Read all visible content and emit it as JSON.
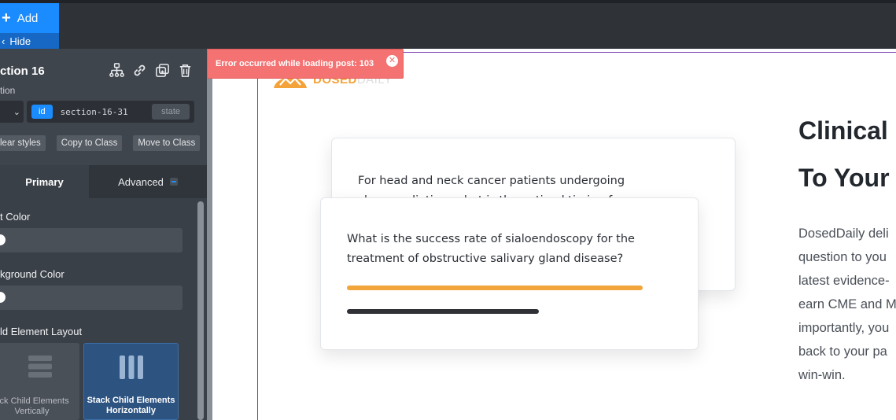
{
  "toolbar": {
    "add_label": "Add",
    "hide_label": "Hide"
  },
  "panel": {
    "title": "ction 16",
    "subtitle": "tion",
    "selector": {
      "id_badge": "id",
      "id_value": "section-16-31",
      "state_badge": "state"
    },
    "actions": {
      "clear_styles": "lear styles",
      "copy_to_class": "Copy to Class",
      "move_to_class": "Move to Class"
    },
    "tabs": {
      "primary": "Primary",
      "advanced": "Advanced"
    },
    "fields": {
      "text_color": "t Color",
      "background_color": "kground Color",
      "child_layout": "ld Element Layout"
    },
    "layout_options": {
      "vertical": {
        "line1": "ack Child Elements",
        "line2": "Vertically"
      },
      "horizontal": {
        "line1": "Stack Child Elements",
        "line2": "Horizontally"
      }
    }
  },
  "toast": {
    "message": "Error occurred while loading post: 103"
  },
  "canvas": {
    "logo": {
      "brand": "DOSED",
      "suffix": "DAILY"
    },
    "card_back_question": "For head and neck cancer patients undergoing chemoradiation, what is the optimal timing for",
    "card_front_question": "What is the success rate of sialoendoscopy for the treatment of obstructive salivary gland disease?",
    "headline": [
      "Clinical",
      "To Your"
    ],
    "body_lines": [
      "DosedDaily deli",
      "question to you",
      "latest evidence-",
      "earn CME and M",
      "importantly, you",
      "back to your pa",
      "win-win."
    ]
  },
  "colors": {
    "accent": "#1a8cff",
    "brand_orange": "#f2a53b",
    "error": "#f47272"
  }
}
